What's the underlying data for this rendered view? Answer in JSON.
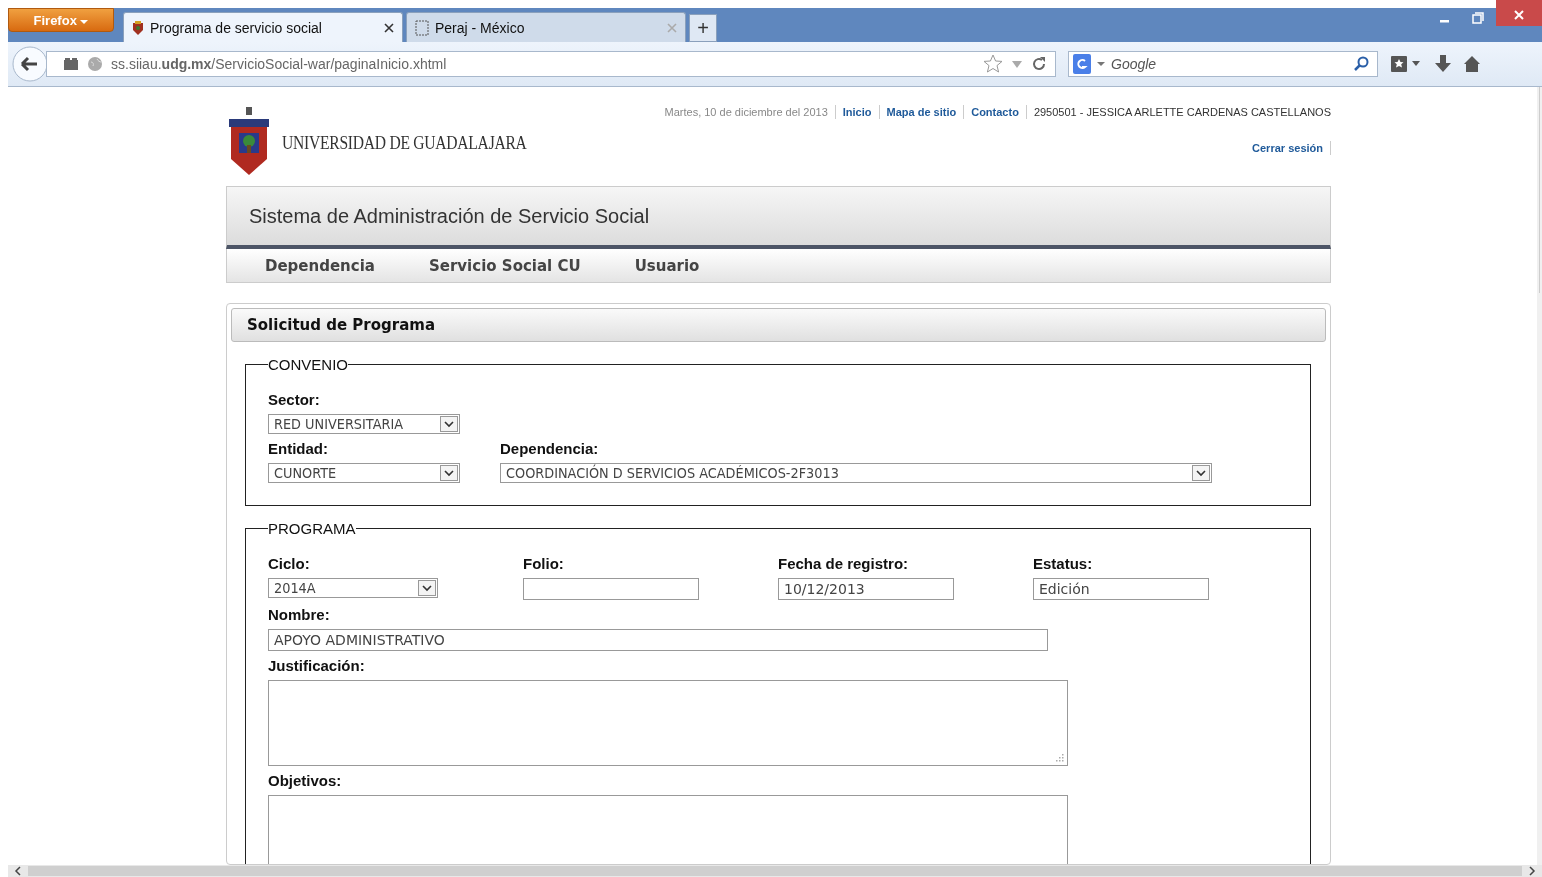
{
  "browser": {
    "menu_button": "Firefox",
    "tabs": [
      {
        "title": "Programa de servicio social",
        "selected": true,
        "kind": "crest"
      },
      {
        "title": "Peraj - México",
        "selected": false,
        "kind": "blank"
      }
    ],
    "new_tab": "+",
    "address": "ss.siiau.**udg.mx**/ServicioSocial-war/paginaInicio.xhtml",
    "search_placeholder": "Google"
  },
  "header": {
    "logo_text": "UNIVERSIDAD DE GUADALAJARA",
    "date": "Martes, 10 de diciembre del 2013",
    "links": [
      "Inicio",
      "Mapa de sitio",
      "Contacto"
    ],
    "user": "2950501 - JESSICA ARLETTE CARDENAS CASTELLANOS",
    "logout": "Cerrar sesión"
  },
  "app_title": "Sistema de Administración de Servicio Social",
  "menu": [
    "Dependencia",
    "Servicio Social CU",
    "Usuario"
  ],
  "panel": {
    "title": "Solicitud de Programa",
    "fieldsets": [
      {
        "legend": "CONVENIO",
        "rows": [
          {
            "fields": [
              {
                "label": "Sector:",
                "kind": "select",
                "value": "RED UNIVERSITARIA"
              }
            ]
          },
          {
            "fields": [
              {
                "label": "Entidad:",
                "kind": "select",
                "value": "CUNORTE"
              },
              {
                "label": "Dependencia:",
                "kind": "wide-select",
                "value": "COORDINACIÓN D SERVICIOS ACADÉMICOS-2F3013"
              }
            ]
          }
        ]
      },
      {
        "legend": "PROGRAMA",
        "rows": [
          {
            "fields": [
              {
                "label": "Ciclo:",
                "kind": "small-select",
                "value": "2014A"
              },
              {
                "label": "Folio:",
                "kind": "text"
              },
              {
                "label": "Fecha de registro:",
                "kind": "text",
                "value": "10/12/2013"
              },
              {
                "label": "Estatus:",
                "kind": "text",
                "value": "Edición"
              }
            ]
          },
          {
            "fields": [
              {
                "label": "Nombre:",
                "kind": "wide-text",
                "value": "APOYO ADMINISTRATIVO"
              }
            ]
          },
          {
            "fields": [
              {
                "label": "Justificación:",
                "kind": "textarea"
              }
            ]
          },
          {
            "fields": [
              {
                "label": "Objetivos:",
                "kind": "textarea"
              }
            ]
          }
        ]
      }
    ]
  }
}
